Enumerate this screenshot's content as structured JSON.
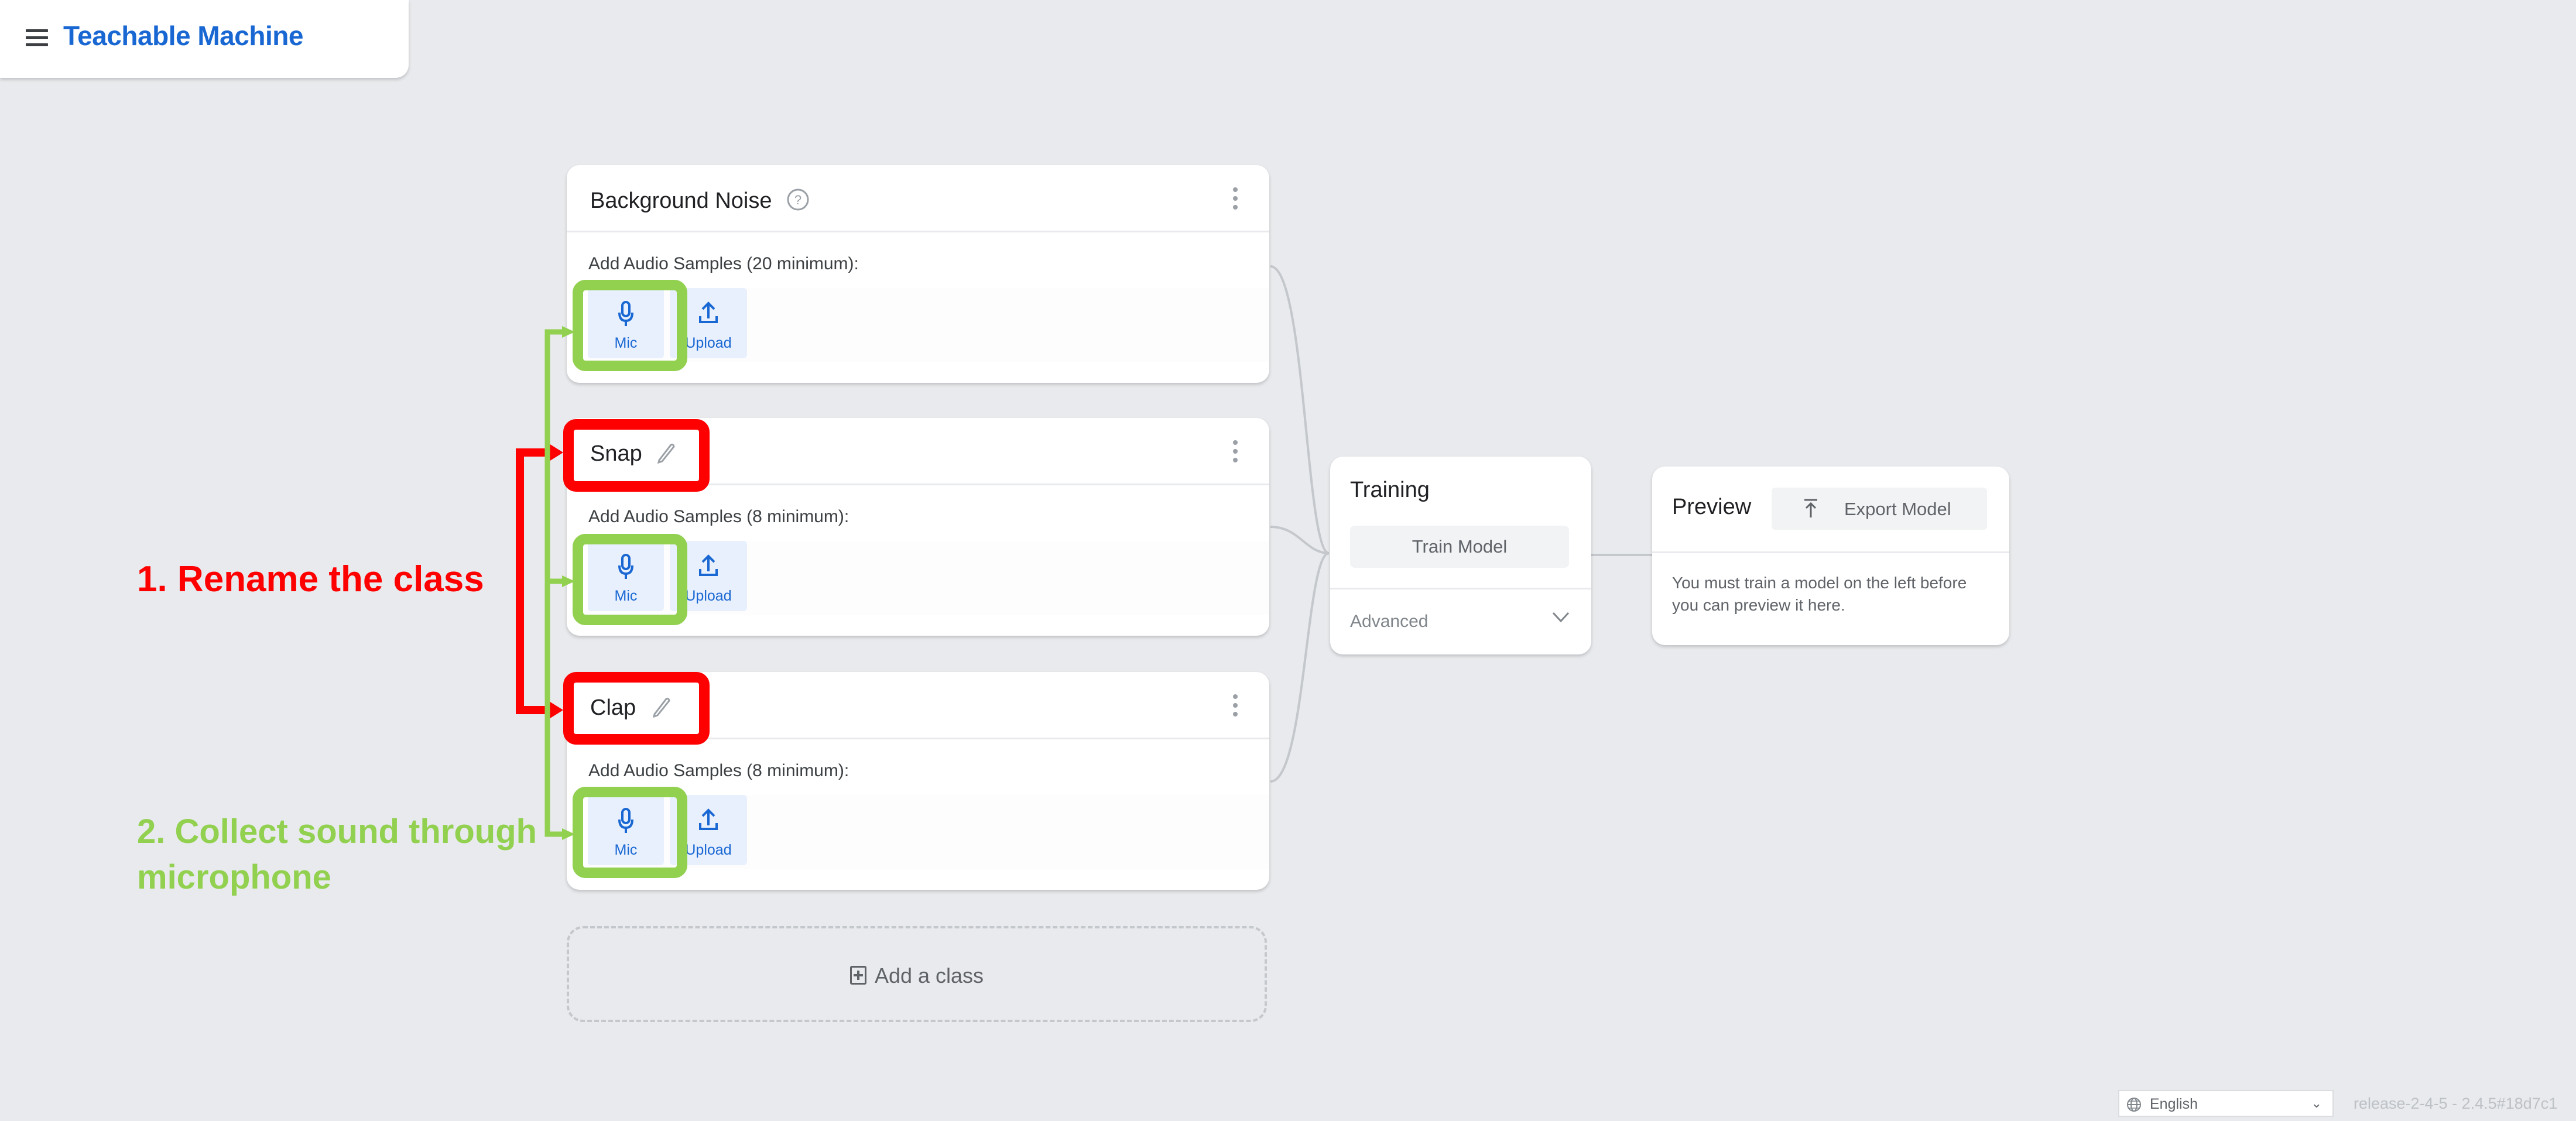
{
  "app": {
    "title": "Teachable Machine",
    "menu_icon": "hamburger-menu-icon"
  },
  "classes": [
    {
      "name": "Background Noise",
      "header_icon": "help-circle-icon",
      "samples_label": "Add Audio Samples (20 minimum):",
      "mic_label": "Mic",
      "upload_label": "Upload"
    },
    {
      "name": "Snap",
      "header_icon": "pencil-edit-icon",
      "samples_label": "Add Audio Samples (8 minimum):",
      "mic_label": "Mic",
      "upload_label": "Upload"
    },
    {
      "name": "Clap",
      "header_icon": "pencil-edit-icon",
      "samples_label": "Add Audio Samples (8 minimum):",
      "mic_label": "Mic",
      "upload_label": "Upload"
    }
  ],
  "add_class": {
    "label": "Add a class",
    "icon": "add-box-icon"
  },
  "training": {
    "title": "Training",
    "train_button": "Train Model",
    "advanced_label": "Advanced"
  },
  "preview": {
    "title": "Preview",
    "export_button": "Export Model",
    "message": "You must train a model on the left before you can preview it here."
  },
  "footer": {
    "language": "English",
    "version": "release-2-4-5 - 2.4.5#18d7c1"
  },
  "annotations": {
    "step1": "1. Rename the class",
    "step2": "2. Collect sound through microphone",
    "colors": {
      "step1": "#ff0000",
      "step2": "#92d050"
    }
  },
  "theme": {
    "brand": "#1967d2",
    "background": "#e8eaed",
    "button_bg": "#e8f0fe"
  }
}
